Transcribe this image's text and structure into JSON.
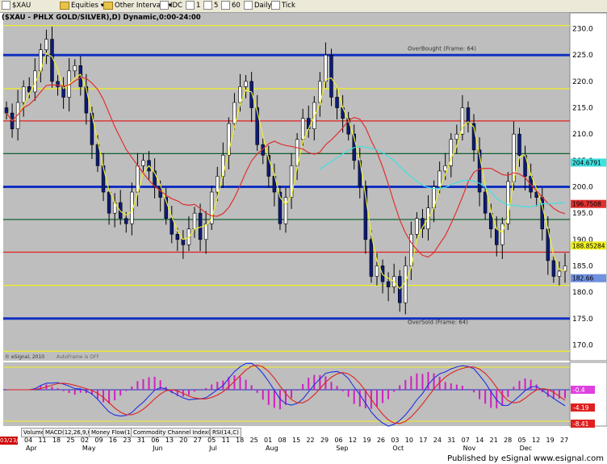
{
  "toolbar": {
    "items": [
      {
        "label": "$XAU",
        "icon": "checkbox-icon"
      },
      {
        "label": "Equities",
        "icon": "folder-icon"
      },
      {
        "label": "Other Intervals",
        "icon": "folder-icon"
      },
      {
        "label": "IDC",
        "icon": "checkbox-icon"
      },
      {
        "label": "1",
        "icon": "checkbox-icon"
      },
      {
        "label": "5",
        "icon": "checkbox-icon"
      },
      {
        "label": "60",
        "icon": "checkbox-icon"
      },
      {
        "label": "Daily",
        "icon": "checkbox-icon"
      },
      {
        "label": "Tick",
        "icon": "checkbox-icon"
      }
    ]
  },
  "chart_title": "($XAU - PHLX GOLD/SILVER),D) Dynamic,0:00-24:00",
  "annotations": {
    "overbought": "OverBought (Frame: 64)",
    "oversold": "OverSold (Frame: 64)",
    "copyright": "© eSignal, 2010",
    "autoframe": "AutoFrame is OFF"
  },
  "indicator_tabs": [
    "Volume",
    "MACD(12,26,9,C)",
    "Money Flow(14)",
    "Commodity Channel Index(23,C)",
    "RSI(14,C)"
  ],
  "date_box": "03/23/11",
  "footer": "Published by eSignal   www.esignal.com",
  "colors": {
    "background": "#bebebe",
    "up_candle": "#ffffff",
    "down_candle": "#0c1c78",
    "blue_level": "#1030c0",
    "red_level": "#e02020",
    "yellow_level": "#f0f020",
    "green_level": "#106030",
    "cyan_ma": "#40e0e0",
    "red_ma": "#e03030",
    "yellow_ma": "#f0f030"
  },
  "chart_data": [
    {
      "type": "candlestick",
      "title": "($XAU - PHLX GOLD/SILVER),D) Dynamic,0:00-24:00",
      "ylim": [
        167,
        233
      ],
      "y_ticks": [
        170,
        175,
        180,
        185,
        190,
        195,
        200,
        205,
        210,
        215,
        220,
        225,
        230
      ],
      "x_tick_labels": [
        "04",
        "11",
        "18",
        "25",
        "02",
        "09",
        "16",
        "23",
        "31",
        "06",
        "13",
        "20",
        "27",
        "05",
        "11",
        "18",
        "25",
        "01",
        "08",
        "15",
        "22",
        "29",
        "06",
        "12",
        "19",
        "26",
        "03",
        "10",
        "17",
        "24",
        "31",
        "07",
        "14",
        "21",
        "28",
        "05",
        "12",
        "19",
        "27"
      ],
      "month_labels": [
        "Apr",
        "May",
        "Jun",
        "Jul",
        "Aug",
        "Sep",
        "Oct",
        "Nov",
        "Dec"
      ],
      "levels": [
        {
          "price": 230.6,
          "color": "yellow"
        },
        {
          "price": 225.0,
          "color": "blue",
          "label": "OverBought (Frame: 64)"
        },
        {
          "price": 218.6,
          "color": "yellow"
        },
        {
          "price": 212.5,
          "color": "red"
        },
        {
          "price": 206.3,
          "color": "green"
        },
        {
          "price": 200.0,
          "color": "blue"
        },
        {
          "price": 193.8,
          "color": "green"
        },
        {
          "price": 187.6,
          "color": "red"
        },
        {
          "price": 181.3,
          "color": "yellow"
        },
        {
          "price": 175.0,
          "color": "blue",
          "label": "OverSold (Frame: 64)"
        },
        {
          "price": 168.8,
          "color": "yellow"
        }
      ],
      "value_labels": [
        {
          "text": "204.6791",
          "price": 204.6,
          "color": "cyan"
        },
        {
          "text": "196.7508",
          "price": 196.75,
          "color": "red"
        },
        {
          "text": "188.85284",
          "price": 188.85,
          "color": "yellow"
        },
        {
          "text": "182.66",
          "price": 182.66,
          "color": "blue"
        }
      ],
      "closes": [
        214,
        211,
        216,
        219,
        218,
        222,
        226,
        228,
        220,
        219,
        217,
        222,
        223,
        219,
        214,
        208,
        204,
        199,
        195,
        197,
        194,
        193,
        199,
        204,
        205,
        203,
        200,
        198,
        194,
        191,
        190,
        189,
        192,
        195,
        190,
        193,
        199,
        202,
        206,
        212,
        216,
        219,
        220,
        215,
        208,
        206,
        202,
        199,
        193,
        198,
        204,
        209,
        213,
        211,
        216,
        220,
        225,
        217,
        215,
        213,
        210,
        205,
        200,
        190,
        183,
        185,
        182,
        181,
        183,
        178,
        185,
        191,
        194,
        192,
        196,
        200,
        203,
        204,
        209,
        210,
        215,
        212,
        207,
        199,
        195,
        192,
        189,
        193,
        201,
        210,
        206,
        202,
        199,
        198,
        192,
        186,
        183,
        184,
        185
      ]
    },
    {
      "type": "line",
      "title": "MACD(12,26,9,C)",
      "value_labels": [
        "-0.4",
        "-4.19",
        "-8.41"
      ]
    }
  ]
}
